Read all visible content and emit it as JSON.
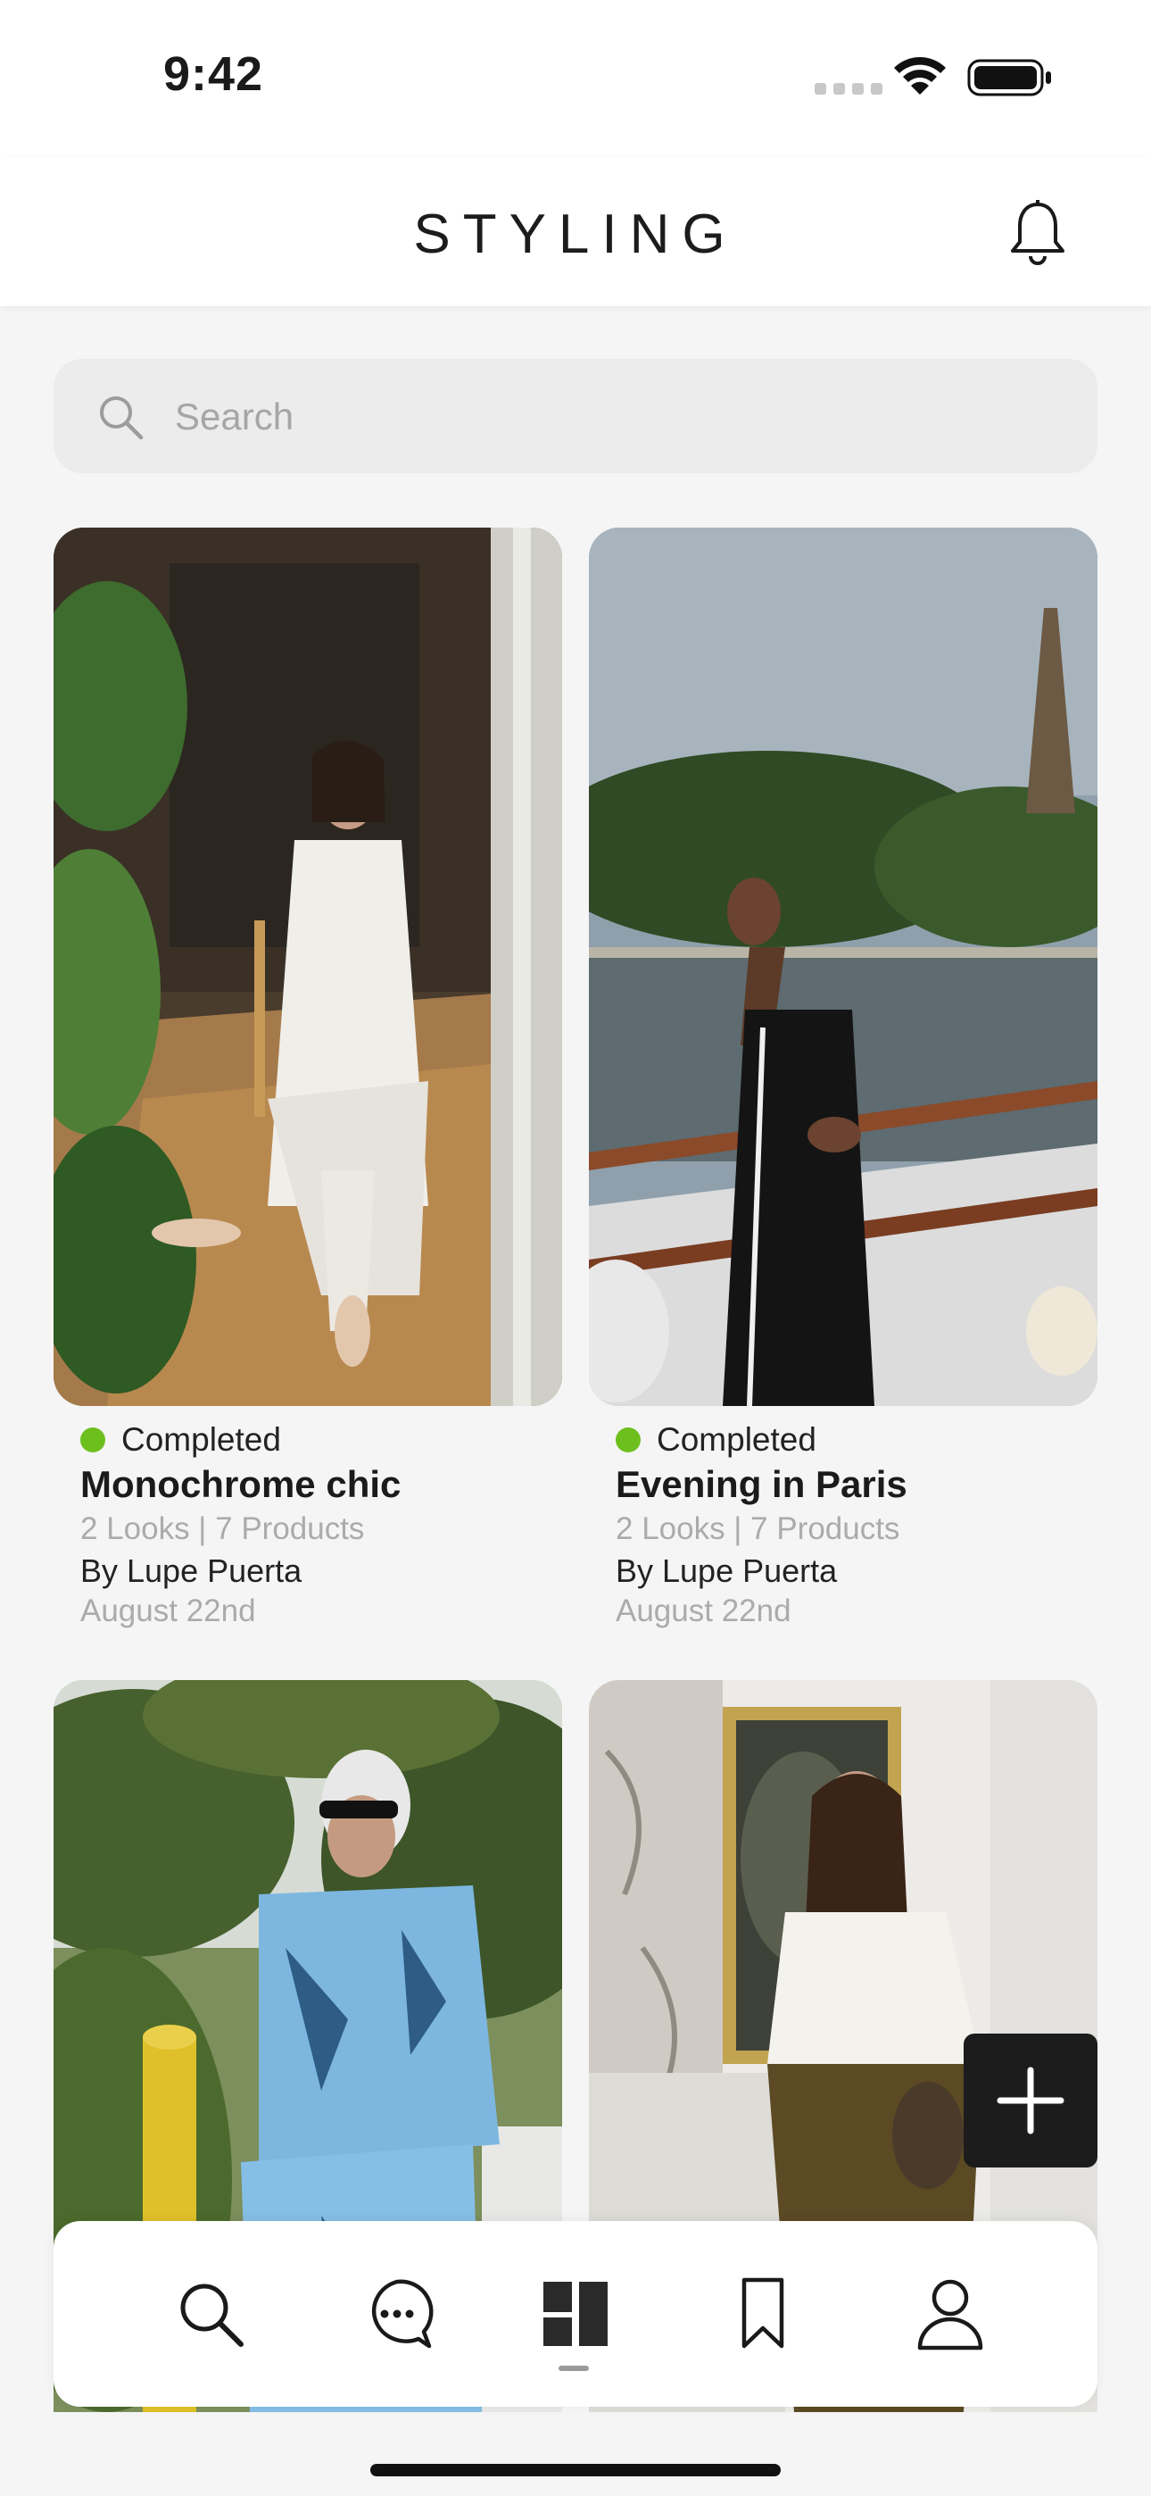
{
  "status_bar": {
    "time": "9:42"
  },
  "header": {
    "title": "STYLING"
  },
  "search": {
    "placeholder": "Search"
  },
  "cards": [
    {
      "status": "Completed",
      "title": "Monochrome chic",
      "meta": "2 Looks | 7 Products",
      "author": "By Lupe Puerta",
      "date": "August 22nd"
    },
    {
      "status": "Completed",
      "title": "Evening in Paris",
      "meta": "2 Looks | 7 Products",
      "author": "By Lupe Puerta",
      "date": "August 22nd"
    },
    {},
    {}
  ],
  "colors": {
    "status_completed": "#6dbf1e",
    "fab": "#1c1c1c",
    "accent_dark": "#1c1c1c"
  },
  "tab_bar": {
    "items": [
      {
        "icon": "search-icon"
      },
      {
        "icon": "chat-icon"
      },
      {
        "icon": "dashboard-icon",
        "active": true
      },
      {
        "icon": "bookmark-icon"
      },
      {
        "icon": "profile-icon"
      }
    ]
  }
}
